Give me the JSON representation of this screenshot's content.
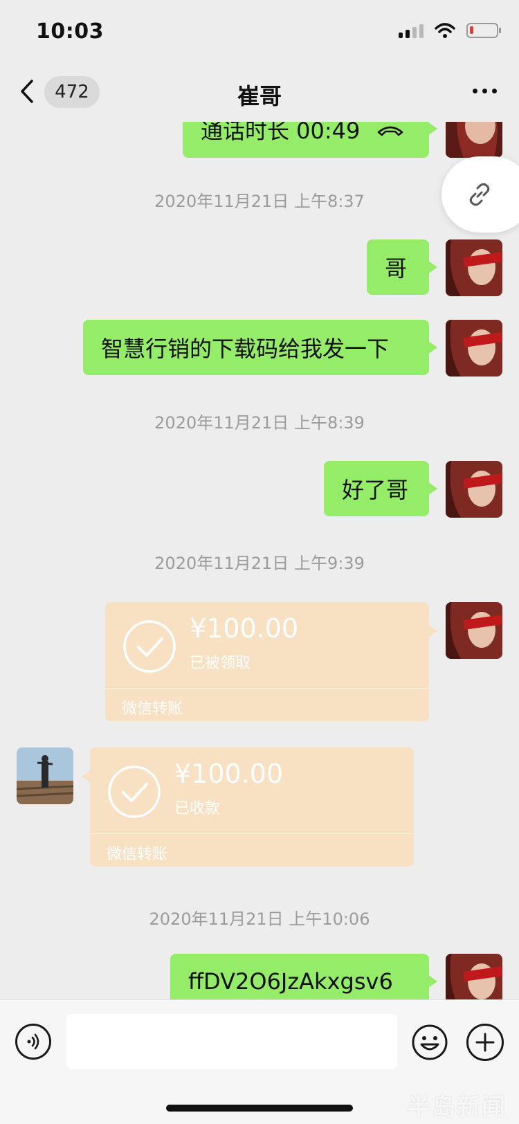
{
  "status_bar": {
    "time": "10:03"
  },
  "nav": {
    "badge": "472",
    "title": "崔哥"
  },
  "messages": {
    "call_duration": "通话时长 00:49",
    "ts1": "2020年11月21日 上午8:37",
    "m1": "哥",
    "m2": "智慧行销的下载码给我发一下",
    "ts2": "2020年11月21日 上午8:39",
    "m3": "好了哥",
    "ts3": "2020年11月21日 上午9:39",
    "transfer_out": {
      "amount": "¥100.00",
      "status": "已被领取",
      "label": "微信转账"
    },
    "transfer_in": {
      "amount": "¥100.00",
      "status": "已收款",
      "label": "微信转账"
    },
    "ts4": "2020年11月21日 上午10:06",
    "m4": "ffDV2O6JzAkxgsv6"
  },
  "input": {
    "placeholder": ""
  },
  "watermark": "半岛新闻",
  "colors": {
    "bubble_green": "#95ec69",
    "transfer_peach": "#f8e1c2",
    "background": "#ededed"
  }
}
